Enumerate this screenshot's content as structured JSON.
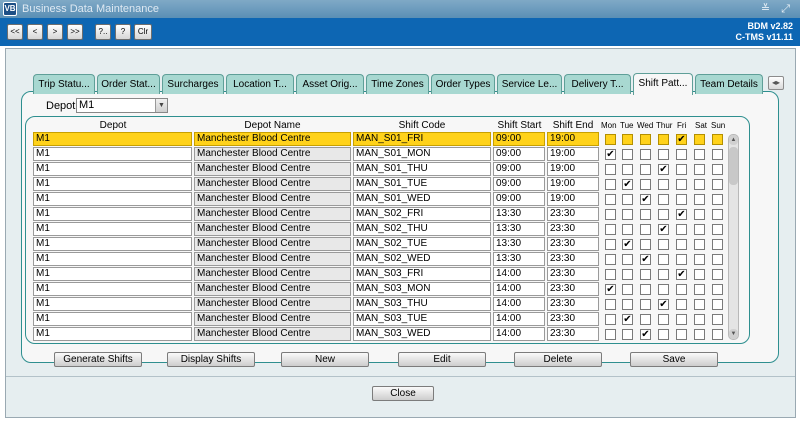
{
  "window": {
    "title": "Business Data Maintenance",
    "app_icon_text": "VB",
    "controls": "≚ ⤢"
  },
  "toolbar": {
    "first_label": "<<",
    "prev_label": "<",
    "next_label": ">",
    "last_label": ">>",
    "help_label": "?..",
    "query_label": "?",
    "clear_label": "Clr"
  },
  "version": {
    "line1": "BDM v2.82",
    "line2": "C-TMS v11.11"
  },
  "tabs": [
    {
      "label": "Trip Statu..."
    },
    {
      "label": "Order Stat..."
    },
    {
      "label": "Surcharges"
    },
    {
      "label": "Location T..."
    },
    {
      "label": "Asset Orig..."
    },
    {
      "label": "Time Zones"
    },
    {
      "label": "Order Types"
    },
    {
      "label": "Service Le..."
    },
    {
      "label": "Delivery T..."
    },
    {
      "label": "Shift Patt..."
    },
    {
      "label": "Team Details"
    }
  ],
  "active_tab": "Shift Patt...",
  "tab_scroll_label": "◂▸",
  "depot_filter": {
    "label": "Depot",
    "value": "M1",
    "arrow": "▼"
  },
  "columns": {
    "depot": "Depot",
    "depot_name": "Depot Name",
    "shift_code": "Shift Code",
    "shift_start": "Shift Start",
    "shift_end": "Shift End",
    "days": [
      "Mon",
      "Tue",
      "Wed",
      "Thur",
      "Fri",
      "Sat",
      "Sun"
    ]
  },
  "rows": [
    {
      "depot": "M1",
      "depot_name": "Manchester Blood Centre",
      "shift_code": "MAN_S01_FRI",
      "start": "09:00",
      "end": "19:00",
      "days": [
        false,
        false,
        false,
        false,
        true,
        false,
        false
      ],
      "selected": true
    },
    {
      "depot": "M1",
      "depot_name": "Manchester Blood Centre",
      "shift_code": "MAN_S01_MON",
      "start": "09:00",
      "end": "19:00",
      "days": [
        true,
        false,
        false,
        false,
        false,
        false,
        false
      ],
      "selected": false
    },
    {
      "depot": "M1",
      "depot_name": "Manchester Blood Centre",
      "shift_code": "MAN_S01_THU",
      "start": "09:00",
      "end": "19:00",
      "days": [
        false,
        false,
        false,
        true,
        false,
        false,
        false
      ],
      "selected": false
    },
    {
      "depot": "M1",
      "depot_name": "Manchester Blood Centre",
      "shift_code": "MAN_S01_TUE",
      "start": "09:00",
      "end": "19:00",
      "days": [
        false,
        true,
        false,
        false,
        false,
        false,
        false
      ],
      "selected": false
    },
    {
      "depot": "M1",
      "depot_name": "Manchester Blood Centre",
      "shift_code": "MAN_S01_WED",
      "start": "09:00",
      "end": "19:00",
      "days": [
        false,
        false,
        true,
        false,
        false,
        false,
        false
      ],
      "selected": false
    },
    {
      "depot": "M1",
      "depot_name": "Manchester Blood Centre",
      "shift_code": "MAN_S02_FRI",
      "start": "13:30",
      "end": "23:30",
      "days": [
        false,
        false,
        false,
        false,
        true,
        false,
        false
      ],
      "selected": false
    },
    {
      "depot": "M1",
      "depot_name": "Manchester Blood Centre",
      "shift_code": "MAN_S02_THU",
      "start": "13:30",
      "end": "23:30",
      "days": [
        false,
        false,
        false,
        true,
        false,
        false,
        false
      ],
      "selected": false
    },
    {
      "depot": "M1",
      "depot_name": "Manchester Blood Centre",
      "shift_code": "MAN_S02_TUE",
      "start": "13:30",
      "end": "23:30",
      "days": [
        false,
        true,
        false,
        false,
        false,
        false,
        false
      ],
      "selected": false
    },
    {
      "depot": "M1",
      "depot_name": "Manchester Blood Centre",
      "shift_code": "MAN_S02_WED",
      "start": "13:30",
      "end": "23:30",
      "days": [
        false,
        false,
        true,
        false,
        false,
        false,
        false
      ],
      "selected": false
    },
    {
      "depot": "M1",
      "depot_name": "Manchester Blood Centre",
      "shift_code": "MAN_S03_FRI",
      "start": "14:00",
      "end": "23:30",
      "days": [
        false,
        false,
        false,
        false,
        true,
        false,
        false
      ],
      "selected": false
    },
    {
      "depot": "M1",
      "depot_name": "Manchester Blood Centre",
      "shift_code": "MAN_S03_MON",
      "start": "14:00",
      "end": "23:30",
      "days": [
        true,
        false,
        false,
        false,
        false,
        false,
        false
      ],
      "selected": false
    },
    {
      "depot": "M1",
      "depot_name": "Manchester Blood Centre",
      "shift_code": "MAN_S03_THU",
      "start": "14:00",
      "end": "23:30",
      "days": [
        false,
        false,
        false,
        true,
        false,
        false,
        false
      ],
      "selected": false
    },
    {
      "depot": "M1",
      "depot_name": "Manchester Blood Centre",
      "shift_code": "MAN_S03_TUE",
      "start": "14:00",
      "end": "23:30",
      "days": [
        false,
        true,
        false,
        false,
        false,
        false,
        false
      ],
      "selected": false
    },
    {
      "depot": "M1",
      "depot_name": "Manchester Blood Centre",
      "shift_code": "MAN_S03_WED",
      "start": "14:00",
      "end": "23:30",
      "days": [
        false,
        false,
        true,
        false,
        false,
        false,
        false
      ],
      "selected": false
    }
  ],
  "check_glyph": "✔",
  "scroll": {
    "up": "▲",
    "down": "▼"
  },
  "actions": {
    "generate": "Generate Shifts",
    "display": "Display Shifts",
    "new": "New",
    "edit": "Edit",
    "delete": "Delete",
    "save": "Save",
    "close": "Close"
  },
  "colors": {
    "toolbar_blue": "#0d66b3",
    "tab_teal": "#a8d8d1",
    "selected_yellow": "#ffd21a",
    "frame_teal": "#2e8f8f"
  }
}
